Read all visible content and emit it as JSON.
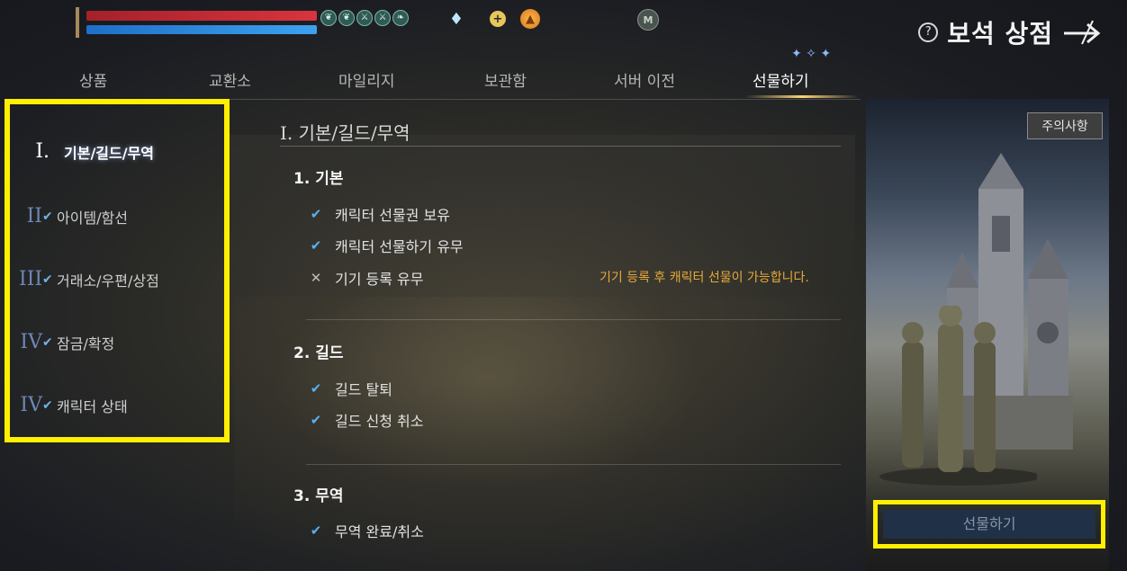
{
  "status": {
    "buff_icons": [
      "leaf-buff-icon",
      "leaf-buff-icon",
      "sword-buff-icon",
      "sword-buff-icon",
      "wing-buff-icon"
    ],
    "currencies": [
      "diamond-icon",
      "plus-icon",
      "gold-coin-icon",
      "mileage-coin-icon"
    ],
    "mileage_glyph": "M",
    "plus_glyph": "+",
    "gold_glyph": "▲"
  },
  "header": {
    "title": "보석 상점",
    "help_glyph": "?"
  },
  "tabs": [
    {
      "label": "상품"
    },
    {
      "label": "교환소"
    },
    {
      "label": "마일리지"
    },
    {
      "label": "보관함"
    },
    {
      "label": "서버 이전"
    },
    {
      "label": "선물하기",
      "active": true
    }
  ],
  "sidebar": {
    "items": [
      {
        "num": "I.",
        "label": "기본/길드/무역",
        "checked": false,
        "active": true
      },
      {
        "num": "II",
        "label": "아이템/함선",
        "checked": true
      },
      {
        "num": "III",
        "label": "거래소/우편/상점",
        "checked": true
      },
      {
        "num": "IV",
        "label": "잠금/확정",
        "checked": true
      },
      {
        "num": "IV",
        "label": "캐릭터 상태",
        "checked": true
      }
    ]
  },
  "main": {
    "section_title": "I. 기본/길드/무역",
    "groups": [
      {
        "title": "1. 기본",
        "rows": [
          {
            "mark": "✔",
            "status": "ok",
            "text": "캐릭터 선물권 보유"
          },
          {
            "mark": "✔",
            "status": "ok",
            "text": "캐릭터 선물하기 유무"
          },
          {
            "mark": "✕",
            "status": "no",
            "text": "기기 등록 유무"
          }
        ],
        "note": "기기 등록 후 캐릭터 선물이 가능합니다."
      },
      {
        "title": "2. 길드",
        "rows": [
          {
            "mark": "✔",
            "status": "ok",
            "text": "길드 탈퇴"
          },
          {
            "mark": "✔",
            "status": "ok",
            "text": "길드 신청 취소"
          }
        ]
      },
      {
        "title": "3. 무역",
        "rows": [
          {
            "mark": "✔",
            "status": "ok",
            "text": "무역 완료/취소"
          }
        ]
      }
    ]
  },
  "panel": {
    "notice_label": "주의사항",
    "gift_button_label": "선물하기"
  },
  "colors": {
    "accent_blue": "#5ab0f0",
    "note_orange": "#e6a93a",
    "highlight_yellow": "#ffef00",
    "hp_red": "#d8343e",
    "mp_blue": "#3da2ee"
  }
}
